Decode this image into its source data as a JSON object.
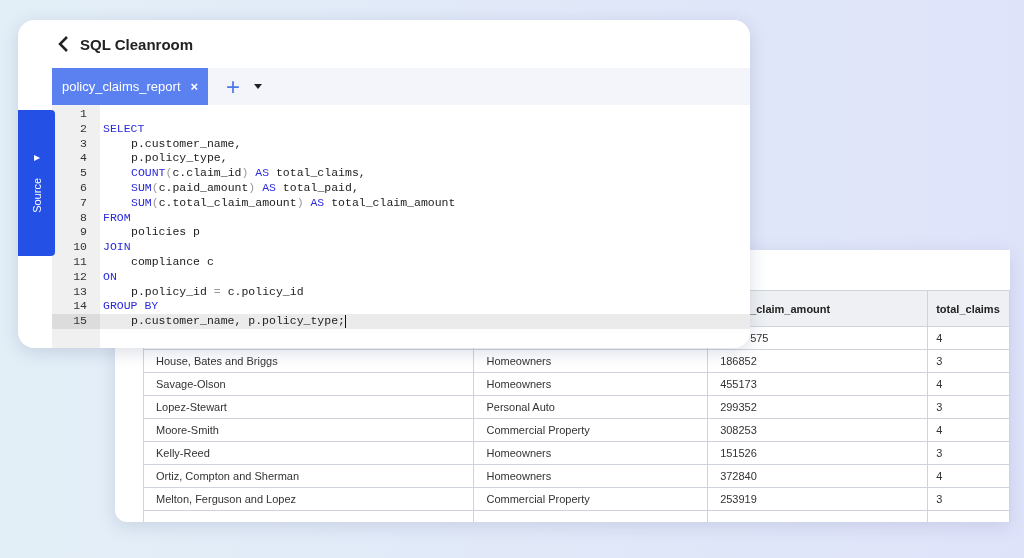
{
  "editor": {
    "title": "SQL Cleanroom",
    "tabs": [
      {
        "label": "policy_claims_report",
        "selected": true,
        "close": "×"
      }
    ],
    "add_tab": "+",
    "source_panel": {
      "label": "Source",
      "arrow": "▸"
    },
    "lines": [
      {
        "number": "1",
        "current": false
      },
      {
        "number": "2",
        "current": false,
        "indent": false,
        "tokens": [
          {
            "kind": "keyword",
            "text": "SELECT"
          }
        ]
      },
      {
        "number": "3",
        "current": false,
        "indent": true,
        "tokens": [
          {
            "kind": "plain",
            "text": "p.customer_name,"
          }
        ]
      },
      {
        "number": "4",
        "current": false,
        "indent": true,
        "tokens": [
          {
            "kind": "plain",
            "text": "p.policy_type,"
          }
        ]
      },
      {
        "number": "5",
        "current": false,
        "indent": true,
        "tokens": [
          {
            "kind": "keyword",
            "text": "COUNT"
          },
          {
            "kind": "paren",
            "text": "("
          },
          {
            "kind": "plain",
            "text": "c.claim_id"
          },
          {
            "kind": "paren",
            "text": ")"
          },
          {
            "kind": "keyword",
            "text": " AS"
          },
          {
            "kind": "plain",
            "text": " total_claims,"
          }
        ]
      },
      {
        "number": "6",
        "current": false,
        "indent": true,
        "tokens": [
          {
            "kind": "keyword",
            "text": "SUM"
          },
          {
            "kind": "paren",
            "text": "("
          },
          {
            "kind": "plain",
            "text": "c.paid_amount"
          },
          {
            "kind": "paren",
            "text": ")"
          },
          {
            "kind": "keyword",
            "text": " AS"
          },
          {
            "kind": "plain",
            "text": " total_paid,"
          }
        ]
      },
      {
        "number": "7",
        "current": false,
        "indent": true,
        "tokens": [
          {
            "kind": "keyword",
            "text": "SUM"
          },
          {
            "kind": "paren",
            "text": "("
          },
          {
            "kind": "plain",
            "text": "c.total_claim_amount"
          },
          {
            "kind": "paren",
            "text": ")"
          },
          {
            "kind": "keyword",
            "text": " AS"
          },
          {
            "kind": "plain",
            "text": " total_claim_amount"
          }
        ]
      },
      {
        "number": "8",
        "current": false,
        "indent": false,
        "tokens": [
          {
            "kind": "keyword",
            "text": "FROM"
          }
        ]
      },
      {
        "number": "9",
        "current": false,
        "indent": true,
        "tokens": [
          {
            "kind": "plain",
            "text": "policies p"
          }
        ]
      },
      {
        "number": "10",
        "current": false,
        "indent": false,
        "tokens": [
          {
            "kind": "keyword",
            "text": "JOIN"
          }
        ]
      },
      {
        "number": "11",
        "current": false,
        "indent": true,
        "tokens": [
          {
            "kind": "plain",
            "text": "compliance c"
          }
        ]
      },
      {
        "number": "12",
        "current": false,
        "indent": false,
        "tokens": [
          {
            "kind": "keyword",
            "text": "ON"
          }
        ]
      },
      {
        "number": "13",
        "current": false,
        "indent": true,
        "tokens": [
          {
            "kind": "plain",
            "text": "p.policy_id "
          },
          {
            "kind": "paren",
            "text": "="
          },
          {
            "kind": "plain",
            "text": " c.policy_id"
          }
        ]
      },
      {
        "number": "14",
        "current": false,
        "indent": false,
        "tokens": [
          {
            "kind": "keyword",
            "text": "GROUP BY"
          }
        ]
      },
      {
        "number": "15",
        "current": true,
        "indent": true,
        "tokens": [
          {
            "kind": "plain",
            "text": "p.customer_name, p.policy_type;"
          }
        ]
      }
    ]
  },
  "results": {
    "columns": [
      "_claim_amount",
      "total_claims"
    ],
    "rows": [
      [
        "575",
        "4"
      ],
      [
        "House, Bates and Briggs",
        "Homeowners",
        "186852",
        "3"
      ],
      [
        "Savage-Olson",
        "Homeowners",
        "455173",
        "4"
      ],
      [
        "Lopez-Stewart",
        "Personal Auto",
        "299352",
        "3"
      ],
      [
        "Moore-Smith",
        "Commercial Property",
        "308253",
        "4"
      ],
      [
        "Kelly-Reed",
        "Homeowners",
        "151526",
        "3"
      ],
      [
        "Ortiz, Compton and Sherman",
        "Homeowners",
        "372840",
        "4"
      ],
      [
        "Melton, Ferguson and Lopez",
        "Commercial Property",
        "253919",
        "3"
      ],
      []
    ]
  }
}
